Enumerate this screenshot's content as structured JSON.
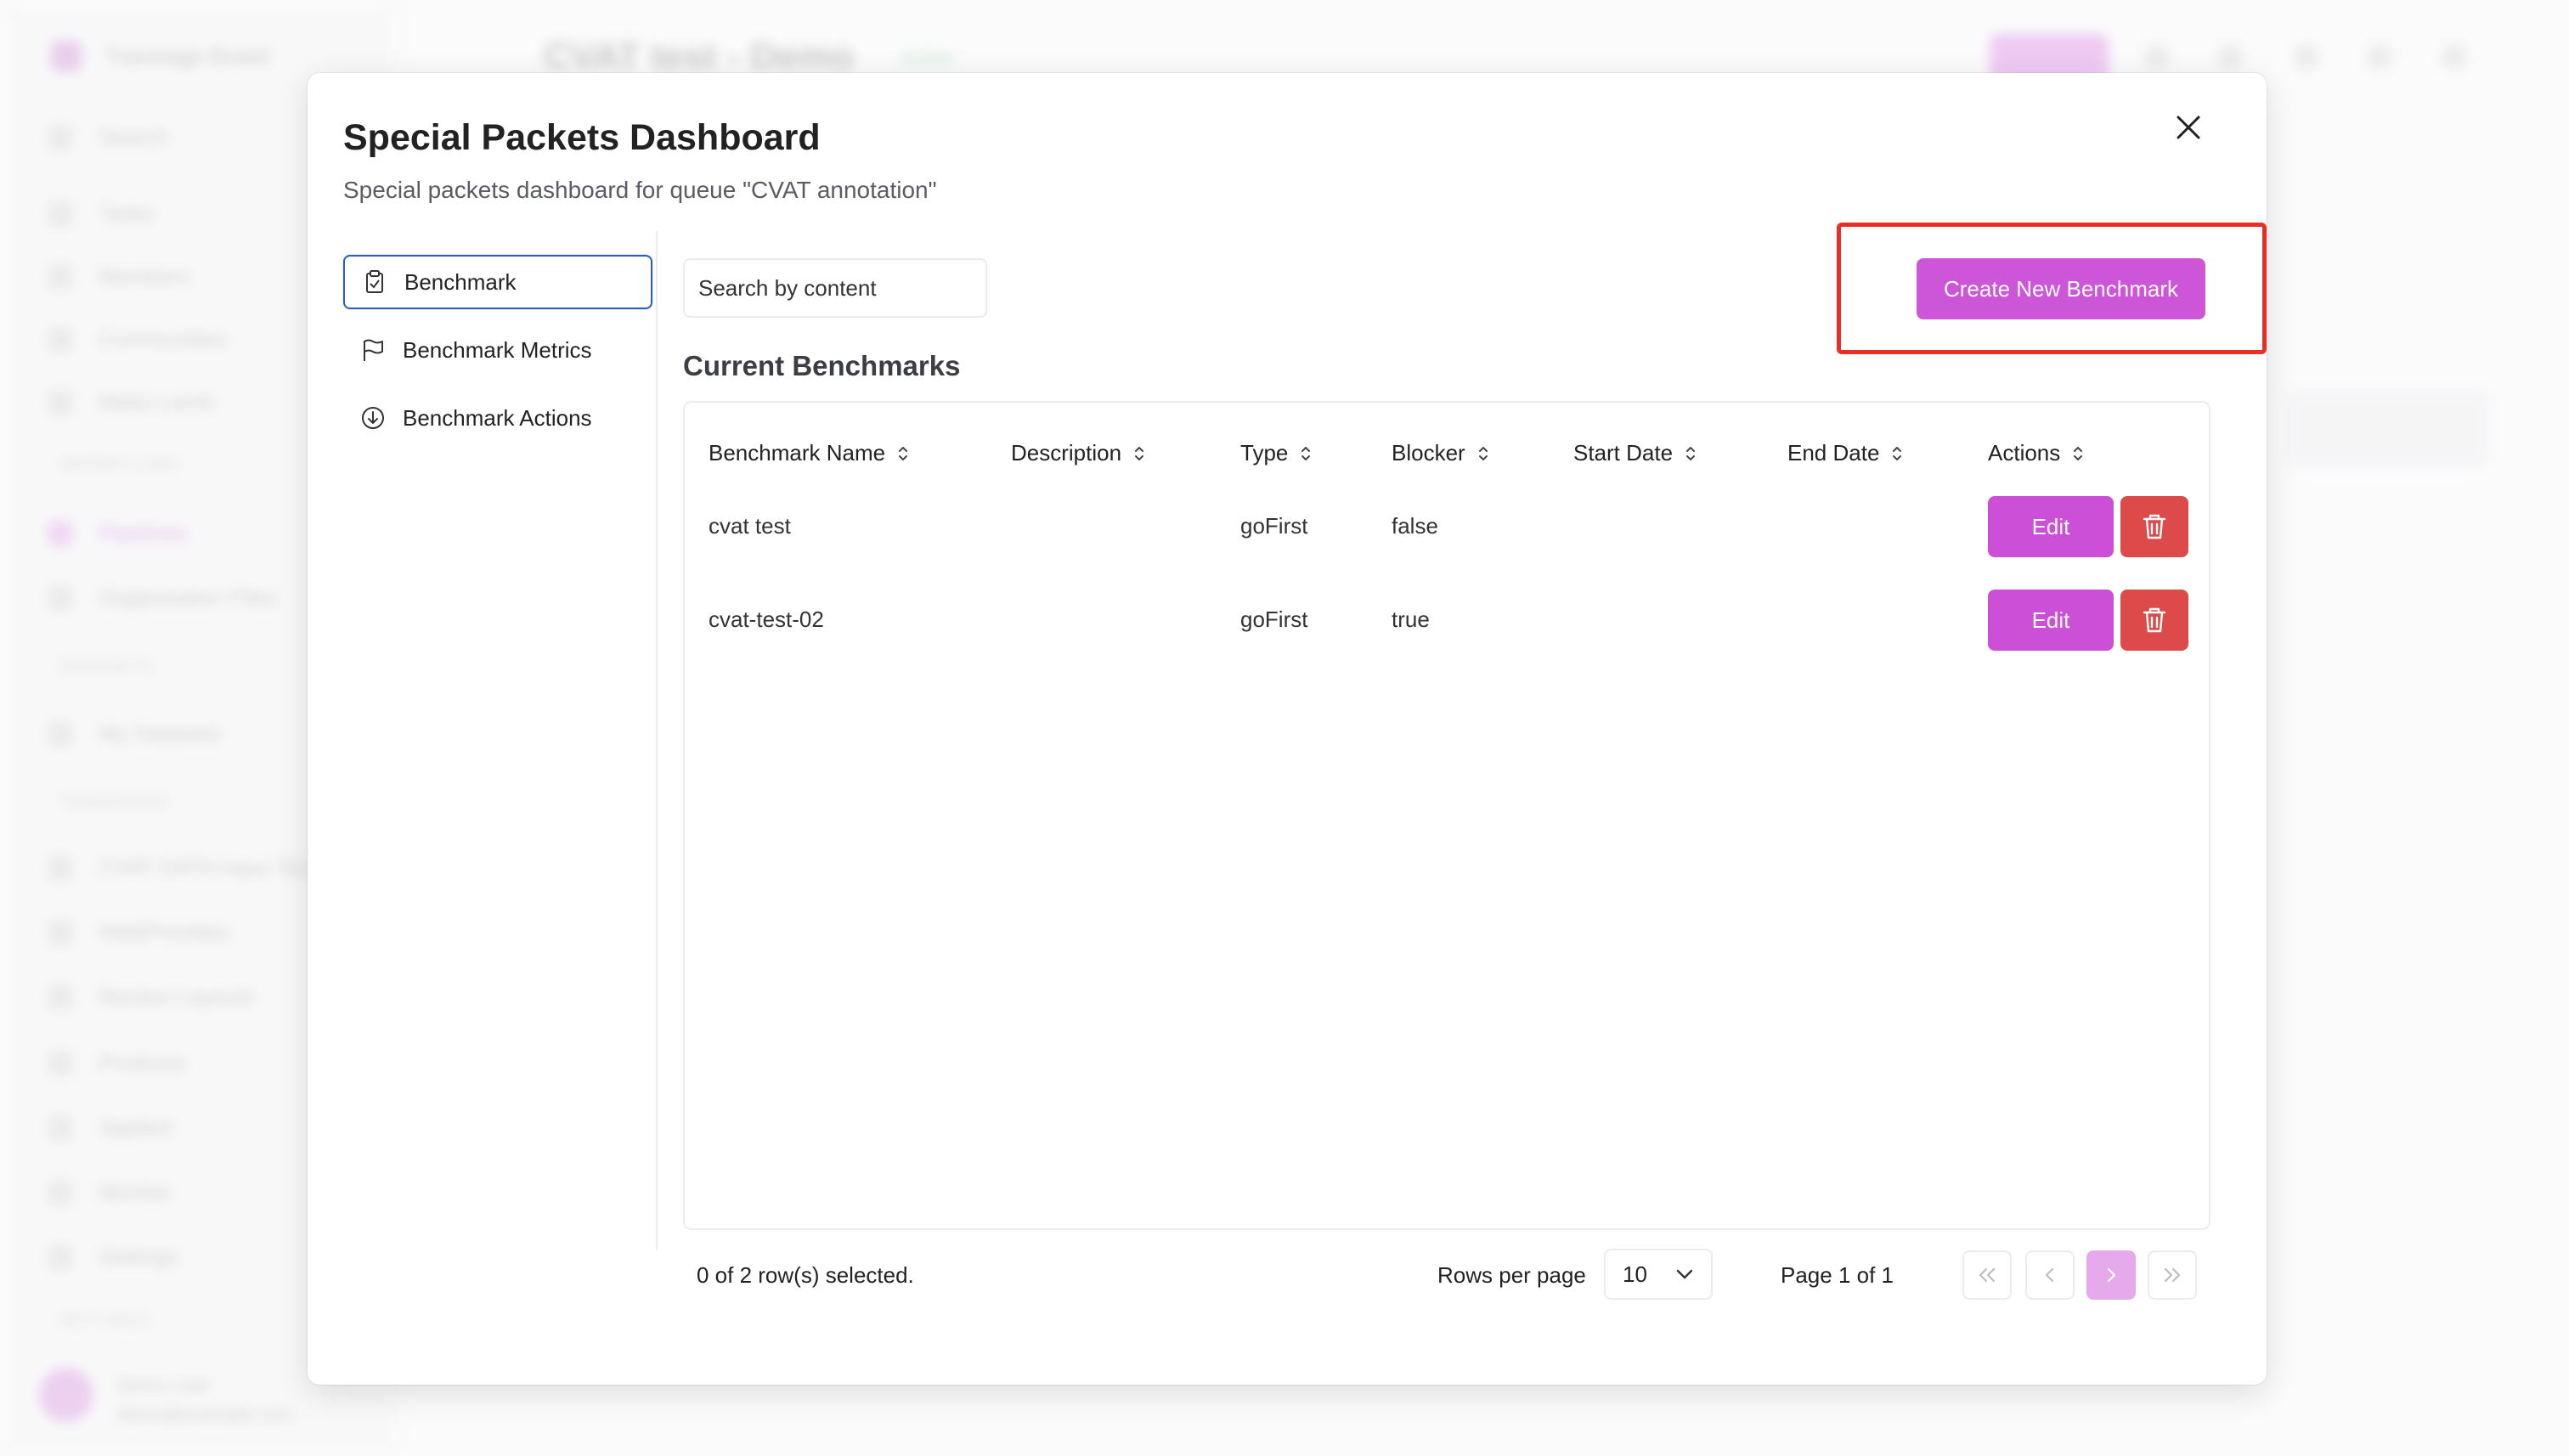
{
  "background": {
    "brand": "Transtage Board",
    "header_title": "CVAT test - Demo",
    "header_status": "Active",
    "nav": [
      "Search",
      "Tasks",
      "Members",
      "Communities",
      "Make Lamb"
    ],
    "section_label": "WORKFLOWS",
    "nav2": [
      "Pipelines",
      "Organization Files"
    ],
    "section_label2": "DATASETS",
    "nav3": [
      "My Datasets"
    ],
    "section_label3": "TEAMSPACE",
    "nav4": [
      "CVAT DATA Input Text",
      "WebPriorities",
      "Review Layouts",
      "Products",
      "Applied",
      "Monitor",
      "Settings"
    ],
    "section_label4": "SETTINGS",
    "user_name": "Demo User",
    "user_email": "demo@example.com"
  },
  "modal": {
    "title": "Special Packets Dashboard",
    "subtitle": "Special packets dashboard for queue \"CVAT annotation\"",
    "nav": [
      {
        "label": "Benchmark",
        "icon": "clipboard-icon"
      },
      {
        "label": "Benchmark Metrics",
        "icon": "flag-icon"
      },
      {
        "label": "Benchmark Actions",
        "icon": "circle-arrow-down-icon"
      }
    ],
    "search_placeholder": "Search by content",
    "create_button": "Create New Benchmark",
    "section_title": "Current Benchmarks",
    "columns": [
      "Benchmark Name",
      "Description",
      "Type",
      "Blocker",
      "Start Date",
      "End Date",
      "Actions"
    ],
    "rows": [
      {
        "name": "cvat test",
        "description": "",
        "type": "goFirst",
        "blocker": "false",
        "start": "",
        "end": "",
        "edit": "Edit"
      },
      {
        "name": "cvat-test-02",
        "description": "",
        "type": "goFirst",
        "blocker": "true",
        "start": "",
        "end": "",
        "edit": "Edit"
      }
    ],
    "footer": {
      "selected": "0 of 2 row(s) selected.",
      "rows_per_page_label": "Rows per page",
      "rows_per_page_value": "10",
      "page_info": "Page 1 of 1"
    }
  },
  "colors": {
    "accent": "#cc55d8",
    "danger": "#dd4a4a",
    "highlight": "#e52f28",
    "active_nav_border": "#2f5eb5"
  }
}
